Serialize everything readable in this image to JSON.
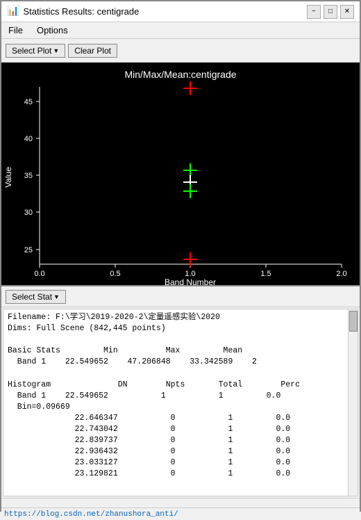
{
  "titleBar": {
    "icon": "📊",
    "title": "Statistics Results: centigrade",
    "minimizeLabel": "−",
    "maximizeLabel": "□",
    "closeLabel": "✕"
  },
  "menuBar": {
    "items": [
      "File",
      "Options"
    ]
  },
  "toolbar": {
    "selectPlotLabel": "Select Plot",
    "clearPlotLabel": "Clear Plot"
  },
  "plot": {
    "title": "Min/Max/Mean:centigrade",
    "xAxisLabel": "Band Number",
    "yAxisLabel": "Value",
    "xTicks": [
      "0.0",
      "0.5",
      "1.0",
      "1.5",
      "2.0"
    ],
    "yTicks": [
      "25",
      "30",
      "35",
      "40",
      "45"
    ],
    "colors": {
      "background": "#000000",
      "axes": "#ffffff",
      "redCross": "#ff0000",
      "greenCross": "#00ff00",
      "whiteCross": "#ffffff"
    }
  },
  "statPanel": {
    "selectStatLabel": "Select Stat",
    "content": "Filename: F:\\学习\\2019-2020-2\\定量遥感实验\\2020\nDims: Full Scene (842,445 points)\n\nBasic Stats         Min          Max         Mean\n  Band 1    22.549652    47.206848    33.342589    2\n\nHistogram              DN        Npts       Total        Perc\n  Band 1    22.549652           1           1         0.0\n  Bin=0.09669\n              22.646347           0           1         0.0\n              22.743042           0           1         0.0\n              22.839737           0           1         0.0\n              22.936432           0           1         0.0\n              23.033127           0           1         0.0\n              23.129821           0           1         0.0"
  },
  "statusBar": {
    "url": "https://blog.csdn.net/zhanushora_anti/"
  }
}
